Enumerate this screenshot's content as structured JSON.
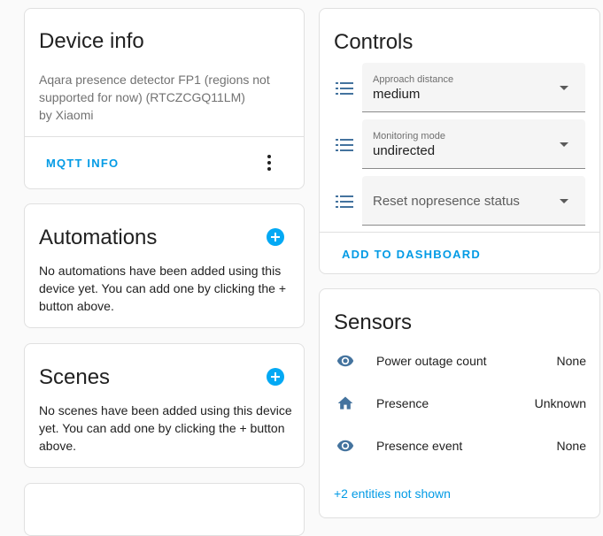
{
  "device_info": {
    "title": "Device info",
    "description": "Aqara presence detector FP1 (regions not supported for now) (RTCZCGQ11LM)",
    "manufacturer": "by Xiaomi",
    "mqtt_info_label": "MQTT INFO"
  },
  "automations": {
    "title": "Automations",
    "empty_text": "No automations have been added using this device yet. You can add one by clicking the + button above."
  },
  "scenes": {
    "title": "Scenes",
    "empty_text": "No scenes have been added using this device yet. You can add one by clicking the + button above."
  },
  "controls": {
    "title": "Controls",
    "selects": [
      {
        "label": "Approach distance",
        "value": "medium",
        "icon": "format-list-icon"
      },
      {
        "label": "Monitoring mode",
        "value": "undirected",
        "icon": "format-list-icon"
      },
      {
        "label": "",
        "value": "Reset nopresence status",
        "icon": "format-list-icon"
      }
    ],
    "add_to_dashboard_label": "ADD TO DASHBOARD"
  },
  "sensors": {
    "title": "Sensors",
    "rows": [
      {
        "name": "Power outage count",
        "value": "None",
        "icon": "eye-icon"
      },
      {
        "name": "Presence",
        "value": "Unknown",
        "icon": "home-icon"
      },
      {
        "name": "Presence event",
        "value": "None",
        "icon": "eye-icon"
      }
    ],
    "hidden_entities_label": "+2 entities not shown"
  },
  "colors": {
    "accent": "#03a9f4",
    "link": "#039be5",
    "icon": "#44739e"
  }
}
